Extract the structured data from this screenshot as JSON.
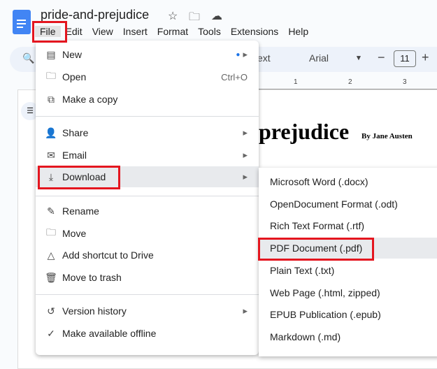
{
  "doc": {
    "title": "pride-and-prejudice",
    "heading": "prejudice",
    "byline": "By Jane Austen"
  },
  "menubar": [
    "File",
    "Edit",
    "View",
    "Insert",
    "Format",
    "Tools",
    "Extensions",
    "Help"
  ],
  "toolbar": {
    "style": "ext",
    "font": "Arial",
    "font_size": "11"
  },
  "ruler": [
    "1",
    "2",
    "3"
  ],
  "file_menu": [
    {
      "icon": "document-icon",
      "label": "New",
      "right": "▸"
    },
    {
      "icon": "folder-icon",
      "label": "Open",
      "right": "Ctrl+O"
    },
    {
      "icon": "copy-icon",
      "label": "Make a copy",
      "right": ""
    },
    {
      "icon": "share-icon",
      "label": "Share",
      "right": "▸"
    },
    {
      "icon": "email-icon",
      "label": "Email",
      "right": "▸"
    },
    {
      "icon": "download-icon",
      "label": "Download",
      "right": "▸"
    },
    {
      "icon": "pencil-icon",
      "label": "Rename",
      "right": ""
    },
    {
      "icon": "move-folder-icon",
      "label": "Move",
      "right": ""
    },
    {
      "icon": "drive-shortcut-icon",
      "label": "Add shortcut to Drive",
      "right": ""
    },
    {
      "icon": "trash-icon",
      "label": "Move to trash",
      "right": ""
    },
    {
      "icon": "history-icon",
      "label": "Version history",
      "right": "▸"
    },
    {
      "icon": "offline-icon",
      "label": "Make available offline",
      "right": ""
    }
  ],
  "download_menu": [
    "Microsoft Word (.docx)",
    "OpenDocument Format (.odt)",
    "Rich Text Format (.rtf)",
    "PDF Document (.pdf)",
    "Plain Text (.txt)",
    "Web Page (.html, zipped)",
    "EPUB Publication (.epub)",
    "Markdown (.md)"
  ],
  "colors": {
    "highlight": "#e4161f",
    "accent": "#4285f4"
  }
}
